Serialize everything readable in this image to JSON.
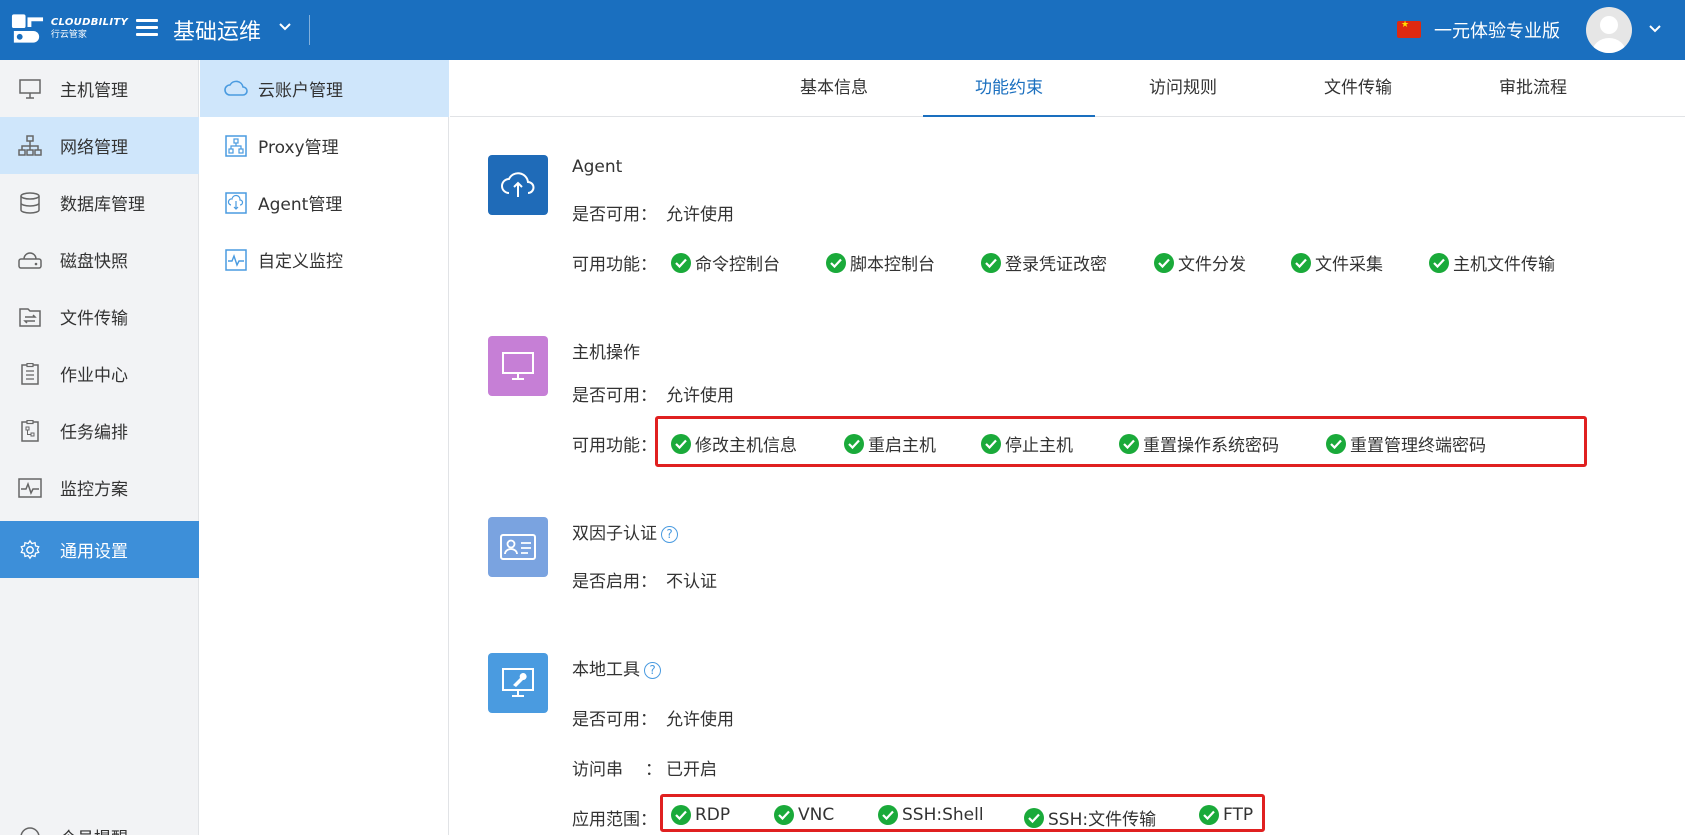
{
  "header": {
    "logo_text": "CLOUDBILITY",
    "logo_sub": "行云管家",
    "app_title": "基础运维",
    "edition": "一元体验专业版"
  },
  "leftnav": {
    "items": [
      {
        "label": "主机管理",
        "icon": "monitor-icon"
      },
      {
        "label": "网络管理",
        "icon": "network-icon"
      },
      {
        "label": "数据库管理",
        "icon": "database-icon"
      },
      {
        "label": "磁盘快照",
        "icon": "disk-icon"
      },
      {
        "label": "文件传输",
        "icon": "file-transfer-icon"
      },
      {
        "label": "作业中心",
        "icon": "clipboard-icon"
      },
      {
        "label": "任务编排",
        "icon": "task-flow-icon"
      },
      {
        "label": "监控方案",
        "icon": "pulse-icon"
      },
      {
        "label": "通用设置",
        "icon": "gear-icon"
      }
    ],
    "partial_item": "个员提醒"
  },
  "subnav": {
    "items": [
      {
        "label": "云账户管理",
        "icon": "cloud-icon"
      },
      {
        "label": "Proxy管理",
        "icon": "proxy-icon"
      },
      {
        "label": "Agent管理",
        "icon": "agent-icon"
      },
      {
        "label": "自定义监控",
        "icon": "custom-monitor-icon"
      }
    ]
  },
  "tabs": [
    "基本信息",
    "功能约束",
    "访问规则",
    "文件传输",
    "审批流程"
  ],
  "active_tab": "功能约束",
  "sections": {
    "agent": {
      "title": "Agent",
      "enabled_label": "是否可用：",
      "enabled_value": "允许使用",
      "features_label": "可用功能：",
      "features": [
        "命令控制台",
        "脚本控制台",
        "登录凭证改密",
        "文件分发",
        "文件采集",
        "主机文件传输"
      ]
    },
    "host_ops": {
      "title": "主机操作",
      "enabled_label": "是否可用：",
      "enabled_value": "允许使用",
      "features_label": "可用功能：",
      "features": [
        "修改主机信息",
        "重启主机",
        "停止主机",
        "重置操作系统密码",
        "重置管理终端密码"
      ]
    },
    "two_factor": {
      "title": "双因子认证",
      "enabled_label": "是否启用：",
      "enabled_value": "不认证"
    },
    "local_tools": {
      "title": "本地工具",
      "enabled_label": "是否可用：",
      "enabled_value": "允许使用",
      "access_label": "访问串",
      "access_colon": "：",
      "access_value": "已开启",
      "scope_label": "应用范围：",
      "scope": [
        "RDP",
        "VNC",
        "SSH:Shell",
        "SSH:文件传输",
        "FTP"
      ]
    }
  },
  "colors": {
    "header": "#1a6fbf",
    "accent": "#1a6fbf",
    "agent_icon_bg": "#1f6bb8",
    "host_icon_bg": "#c67fd6",
    "twofactor_icon_bg": "#7aa3e0",
    "localtool_icon_bg": "#4a9be0",
    "check_green": "#1aaa3a",
    "highlight_red": "#e02020"
  }
}
